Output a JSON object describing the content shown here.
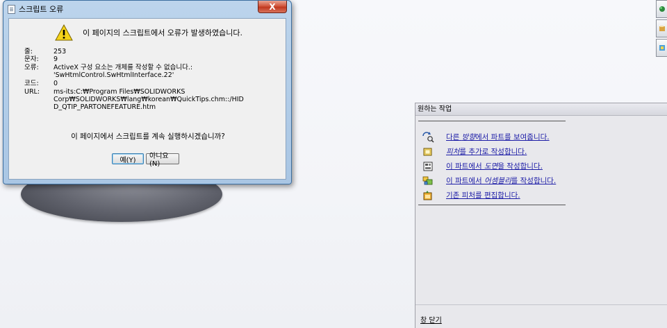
{
  "dialog": {
    "title": "스크립트 오류",
    "close_label": "X",
    "message": "이 페이지의 스크립트에서 오류가 발생하였습니다.",
    "details": [
      {
        "key": "줄:",
        "value": [
          "253"
        ]
      },
      {
        "key": "문자:",
        "value": [
          "9"
        ]
      },
      {
        "key": "오류:",
        "value": [
          "ActiveX 구성 요소는 개체를 작성할 수 없습니다.:",
          "'SwHtmlControl.SwHtmlInterface.22'"
        ]
      },
      {
        "key": "코드:",
        "value": [
          "0"
        ]
      },
      {
        "key": "URL:",
        "value": [
          "ms-its:C:₩Program Files₩SOLIDWORKS",
          "Corp₩SOLIDWORKS₩lang₩korean₩QuickTips.chm::/HID",
          "D_QTIP_PARTONEFEATURE.htm"
        ]
      }
    ],
    "continue_prompt": "이 페이지에서 스크립트를 계속 실행하시겠습니까?",
    "yes_label": "예(Y)",
    "no_label": "아니요(N)"
  },
  "taskpane": {
    "title": "원하는 작업",
    "items": [
      {
        "icon": "rotate-view-icon",
        "before": "다른 ",
        "em": "방향",
        "after": "에서 파트를 보여줍니다."
      },
      {
        "icon": "feature-icon",
        "before": "",
        "em": "피처",
        "after": "를 추가로 작성합니다."
      },
      {
        "icon": "drawing-icon",
        "before": "이 파트에서 ",
        "em": "도면",
        "after": "을 작성합니다."
      },
      {
        "icon": "assembly-icon",
        "before": "이 파트에서 ",
        "em": "어셈블리",
        "after": "를 작성합니다."
      },
      {
        "icon": "edit-feature-icon",
        "before": "기존 피처를 편집합니다.",
        "em": "",
        "after": ""
      }
    ],
    "close_label": "창 닫기"
  }
}
